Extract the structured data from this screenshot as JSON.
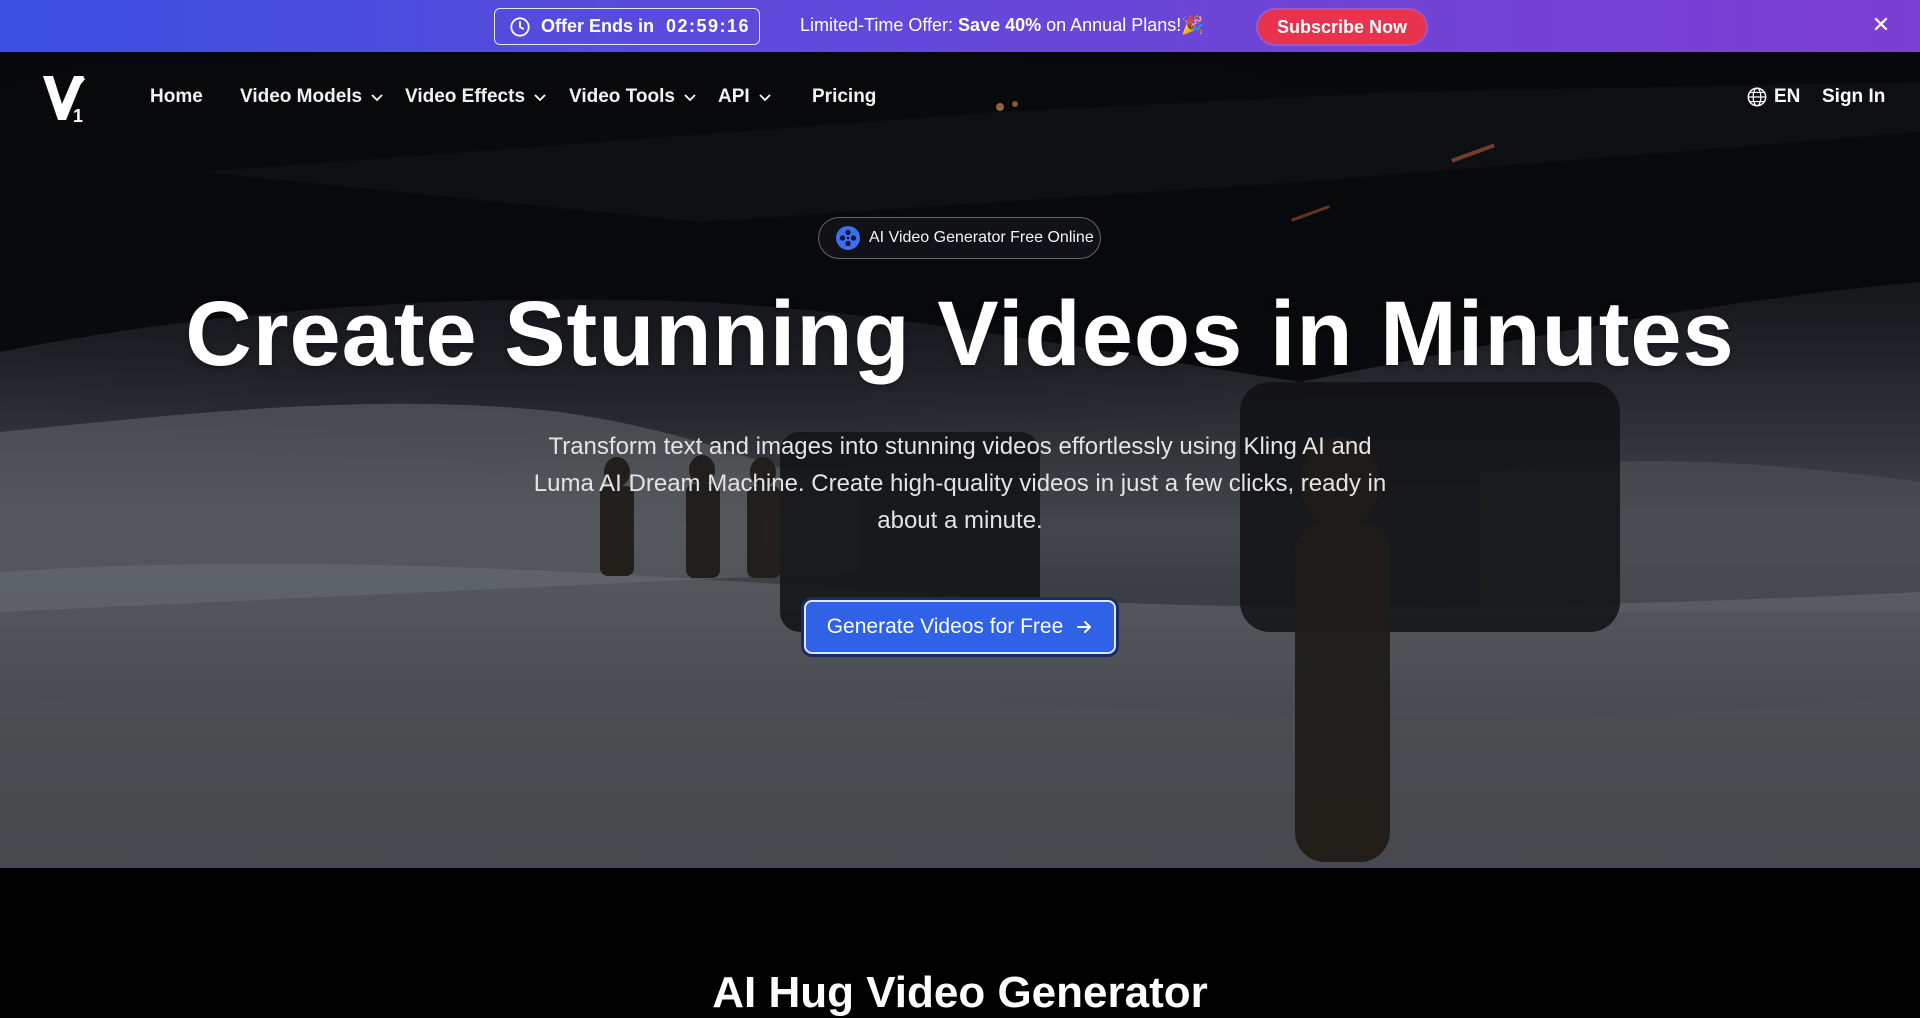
{
  "promo": {
    "timer_label": "Offer Ends in",
    "timer_value": "02:59:16",
    "offer_prefix": "Limited-Time Offer: ",
    "offer_highlight": "Save 40%",
    "offer_suffix": " on Annual Plans!🎉",
    "subscribe_label": "Subscribe Now",
    "close_label": "✕"
  },
  "nav": {
    "items": [
      {
        "label": "Home"
      },
      {
        "label": "Video Models"
      },
      {
        "label": "Video Effects"
      },
      {
        "label": "Video Tools"
      },
      {
        "label": "API"
      },
      {
        "label": "Pricing"
      }
    ],
    "language": "EN",
    "signin_label": "Sign In"
  },
  "hero": {
    "badge_label": "AI Video Generator Free Online",
    "headline": "Create Stunning Videos in Minutes",
    "subtext": "Transform text and images into stunning videos effortlessly using Kling AI and Luma AI Dream Machine. Create high-quality videos in just a few clicks, ready in about a minute.",
    "cta_label": "Generate Videos for Free"
  },
  "next_section": {
    "title": "AI Hug Video Generator"
  },
  "colors": {
    "banner_start": "#3b4fe0",
    "banner_end": "#7b3fd2",
    "subscribe": "#e8324e",
    "cta": "#2f62e6"
  }
}
